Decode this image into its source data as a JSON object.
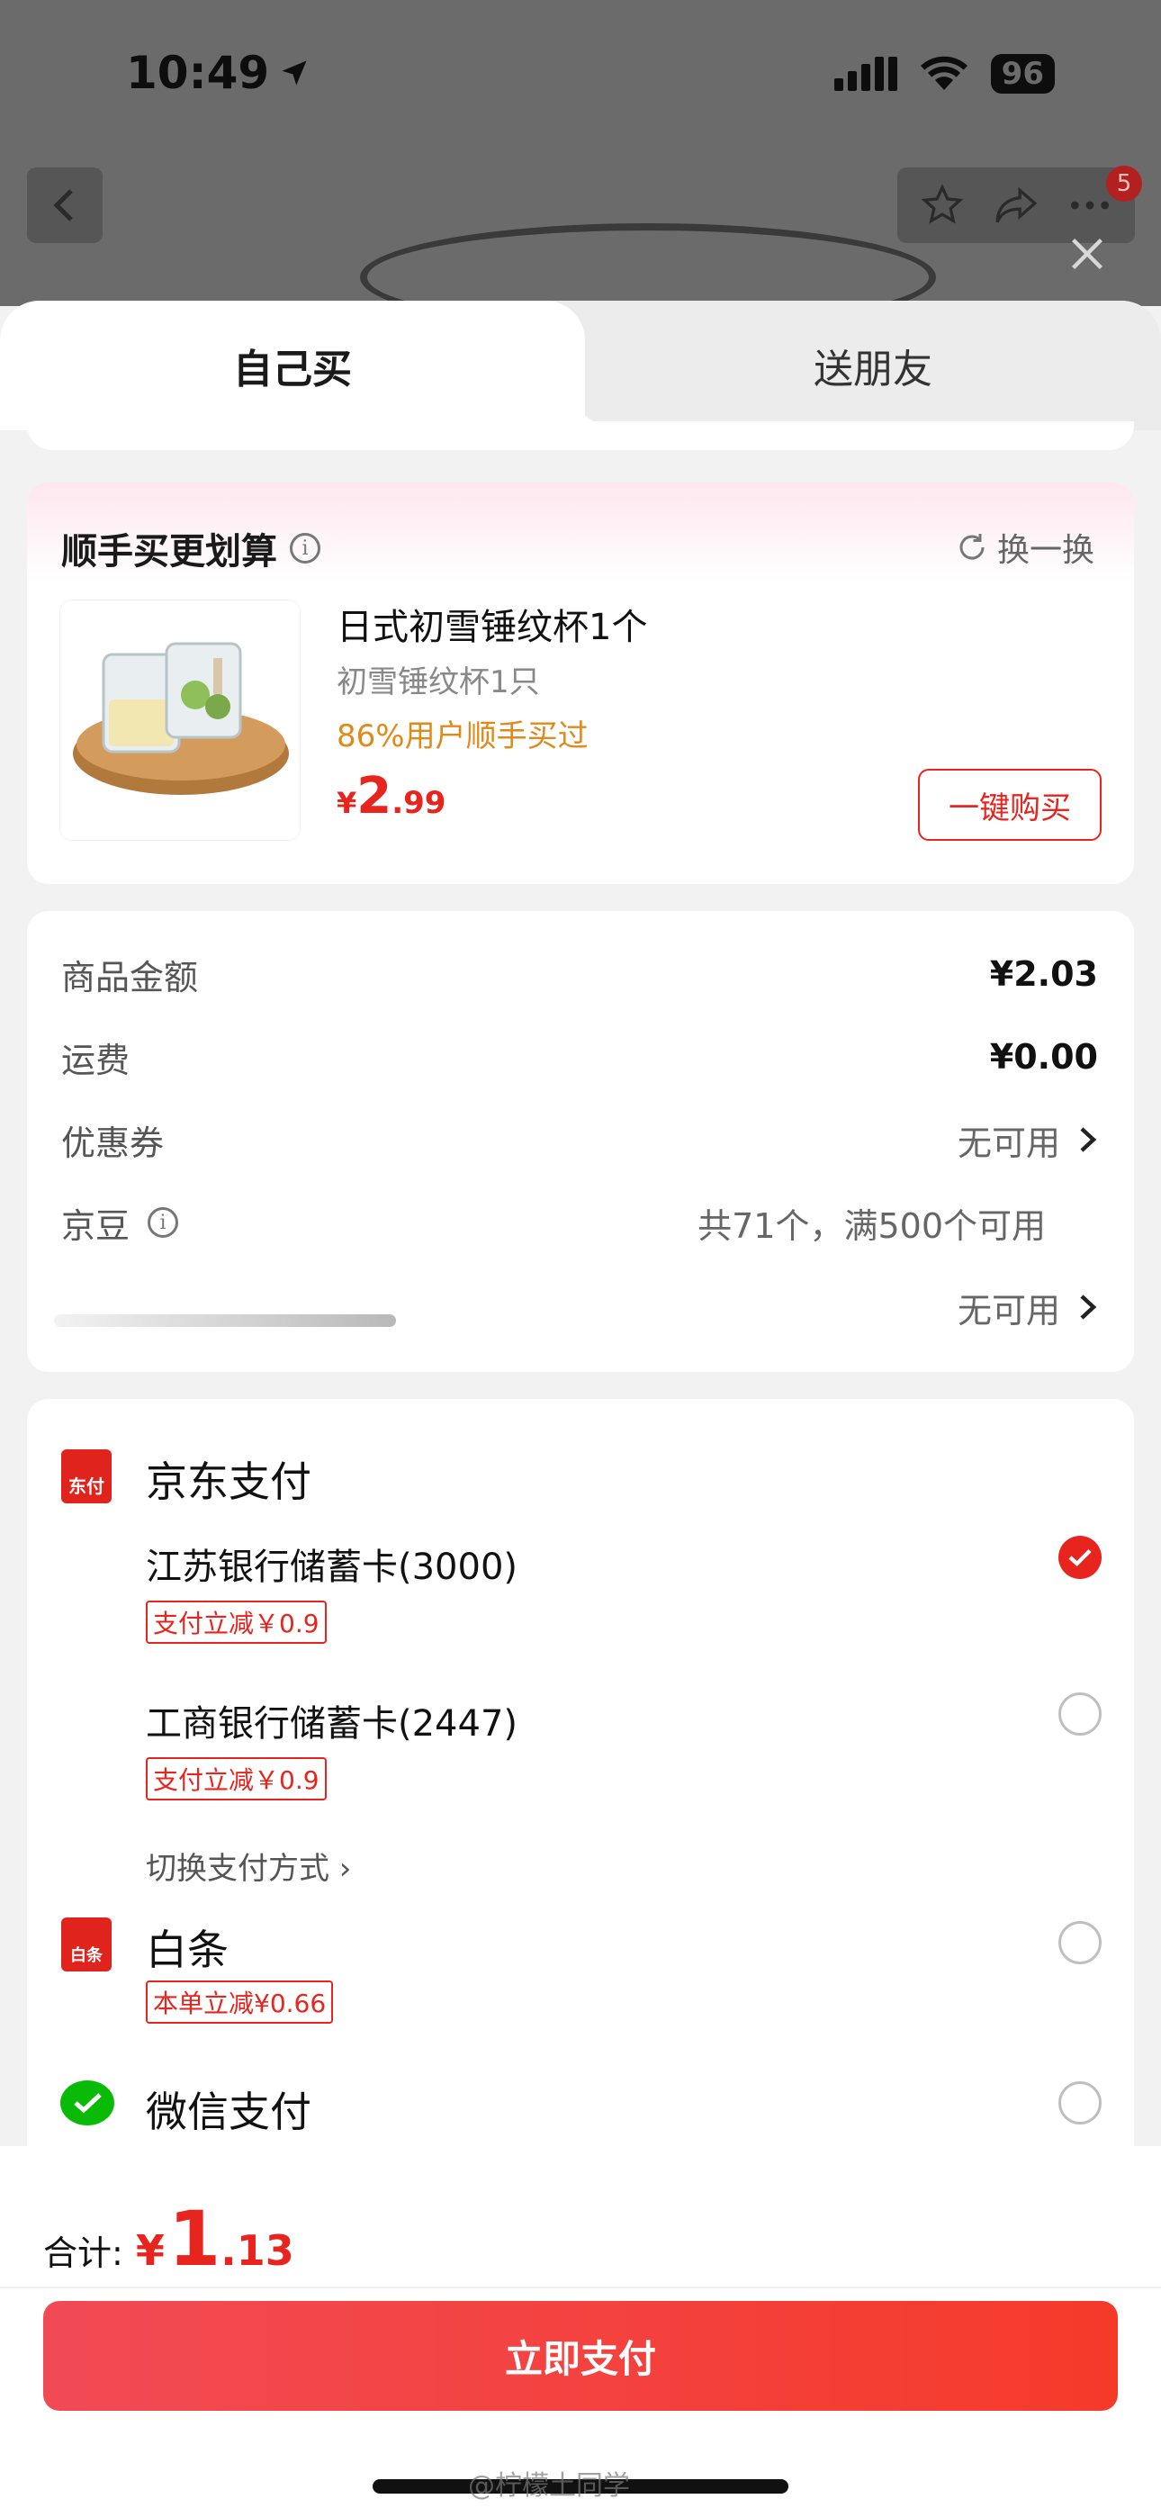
{
  "status_bar": {
    "time": "10:49",
    "battery": "96"
  },
  "nav": {
    "cart_badge": "5"
  },
  "tabs": {
    "self": "自己买",
    "gift": "送朋友"
  },
  "upsell": {
    "title": "顺手买更划算",
    "refresh_label": "换一换",
    "product": {
      "name": "日式初雪锤纹杯1个",
      "spec": "初雪锤纹杯1只",
      "hint": "86%用户顺手买过",
      "price_symbol": "¥",
      "price_int": "2",
      "price_dec": ".99",
      "buy_label": "一键购买"
    }
  },
  "summary": {
    "goods_label": "商品金额",
    "goods_value": "¥2.03",
    "shipping_label": "运费",
    "shipping_value": "¥0.00",
    "coupon_label": "优惠券",
    "coupon_value": "无可用",
    "jd_bean_label": "京豆",
    "jd_bean_value": "共71个，满500个可用",
    "other_value": "无可用"
  },
  "payment": {
    "jd_pay": {
      "logo_text": "东付",
      "title": "京东支付",
      "cards": [
        {
          "name": "江苏银行储蓄卡(3000)",
          "promo": "支付立减￥0.9",
          "selected": true
        },
        {
          "name": "工商银行储蓄卡(2447)",
          "promo": "支付立减￥0.9",
          "selected": false
        }
      ],
      "switch_label": "切换支付方式 ›"
    },
    "baitiao": {
      "logo_text": "白条",
      "title": "白条",
      "promo": "本单立减¥0.66"
    },
    "wechat": {
      "title": "微信支付"
    }
  },
  "footer": {
    "total_label": "合计:",
    "total_symbol": "¥",
    "total_int": "1",
    "total_dec": ".13",
    "pay_button": "立即支付",
    "watermark": "@柠檬土同学"
  },
  "colors": {
    "accent": "#e8241e",
    "orange_hint": "#e08a1a",
    "wechat_green": "#09bb07"
  }
}
